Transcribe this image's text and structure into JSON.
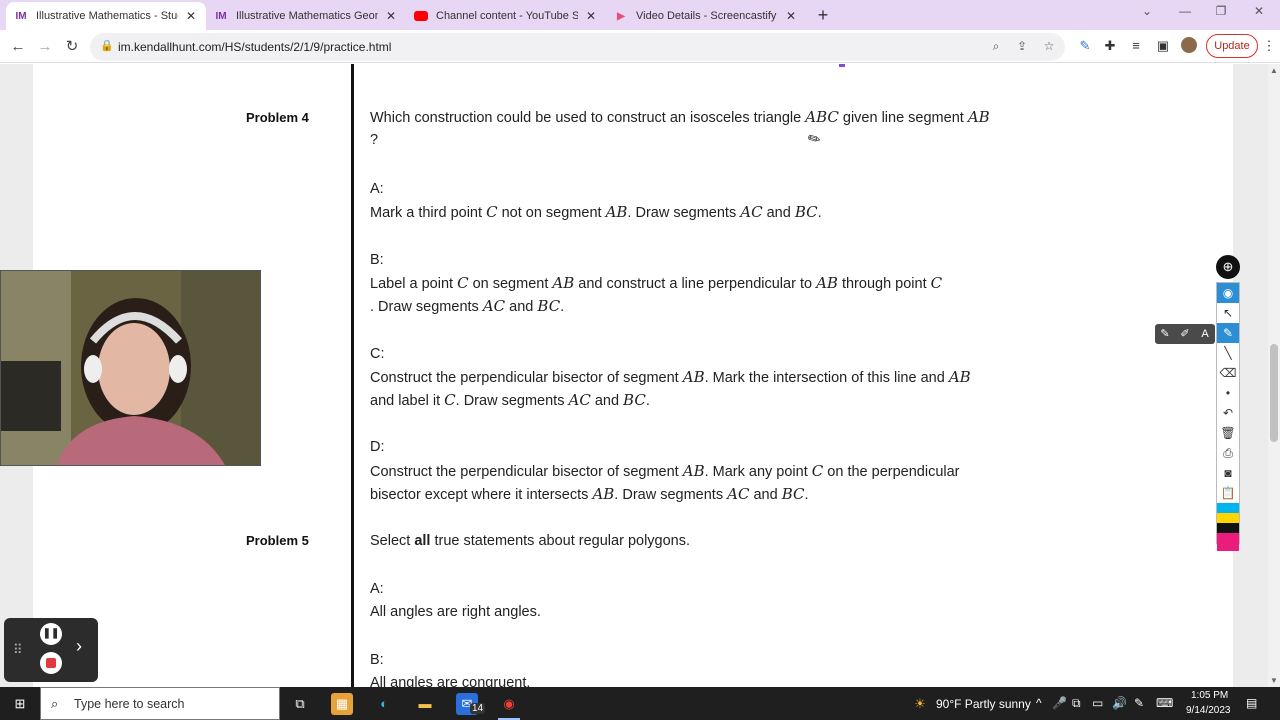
{
  "browser": {
    "tabs": [
      {
        "label": "Illustrative Mathematics - Student",
        "icon": "illustrative-math-favicon",
        "active": true
      },
      {
        "label": "Illustrative Mathematics Geometr",
        "icon": "illustrative-math-favicon",
        "active": false
      },
      {
        "label": "Channel content - YouTube Studi",
        "icon": "youtube-favicon",
        "active": false
      },
      {
        "label": "Video Details - Screencastify",
        "icon": "screencastify-favicon",
        "active": false
      }
    ],
    "url": "im.kendallhunt.com/HS/students/2/1/9/practice.html",
    "update_label": "Update",
    "colors": {
      "tabbar": "#e8d6f5",
      "update_border": "#d93025"
    }
  },
  "content": {
    "problem4": {
      "label": "Problem 4",
      "question_pre": "Which construction could be used to construct an isosceles triangle",
      "question_var1": "ABC",
      "question_mid": "given line segment",
      "question_var2": "AB",
      "question_end": "?",
      "options": [
        {
          "letter": "A:",
          "line1": [
            {
              "t": "Mark a third point "
            },
            {
              "m": "C"
            },
            {
              "t": " not on segment "
            },
            {
              "m": "AB"
            },
            {
              "t": ". Draw segments "
            },
            {
              "m": "AC"
            },
            {
              "t": " and "
            },
            {
              "m": "BC"
            },
            {
              "t": "."
            }
          ],
          "line2": []
        },
        {
          "letter": "B:",
          "line1": [
            {
              "t": "Label a point "
            },
            {
              "m": "C"
            },
            {
              "t": " on segment "
            },
            {
              "m": "AB"
            },
            {
              "t": " and construct a line perpendicular to "
            },
            {
              "m": "AB"
            },
            {
              "t": " through point "
            },
            {
              "m": "C"
            }
          ],
          "line2": [
            {
              "t": ". Draw segments "
            },
            {
              "m": "AC"
            },
            {
              "t": " and "
            },
            {
              "m": "BC"
            },
            {
              "t": "."
            }
          ]
        },
        {
          "letter": "C:",
          "line1": [
            {
              "t": "Construct the perpendicular bisector of segment "
            },
            {
              "m": "AB"
            },
            {
              "t": ". Mark the intersection of this line and "
            },
            {
              "m": "AB"
            }
          ],
          "line2": [
            {
              "t": "and label it "
            },
            {
              "m": "C"
            },
            {
              "t": ". Draw segments "
            },
            {
              "m": "AC"
            },
            {
              "t": " and "
            },
            {
              "m": "BC"
            },
            {
              "t": "."
            }
          ]
        },
        {
          "letter": "D:",
          "line1": [
            {
              "t": "Construct the perpendicular bisector of segment "
            },
            {
              "m": "AB"
            },
            {
              "t": ". Mark any point "
            },
            {
              "m": "C"
            },
            {
              "t": " on the perpendicular"
            }
          ],
          "line2": [
            {
              "t": "bisector except where it intersects "
            },
            {
              "m": "AB"
            },
            {
              "t": ". Draw segments "
            },
            {
              "m": "AC"
            },
            {
              "t": " and "
            },
            {
              "m": "BC"
            },
            {
              "t": "."
            }
          ]
        }
      ]
    },
    "problem5": {
      "label": "Problem 5",
      "question_pre": "Select",
      "question_bold": "all",
      "question_post": "true statements about regular polygons.",
      "optionA_letter": "A:",
      "optionA_text": "All angles are right angles.",
      "optionB_letter": "B:",
      "optionB_text": "All angles are congruent."
    }
  },
  "drawing_tools": {
    "float_label": "A"
  },
  "taskbar": {
    "search_placeholder": "Type here to search",
    "weather": "90°F  Partly sunny",
    "time": "1:05 PM",
    "date": "9/14/2023",
    "mail_badge": "14"
  }
}
